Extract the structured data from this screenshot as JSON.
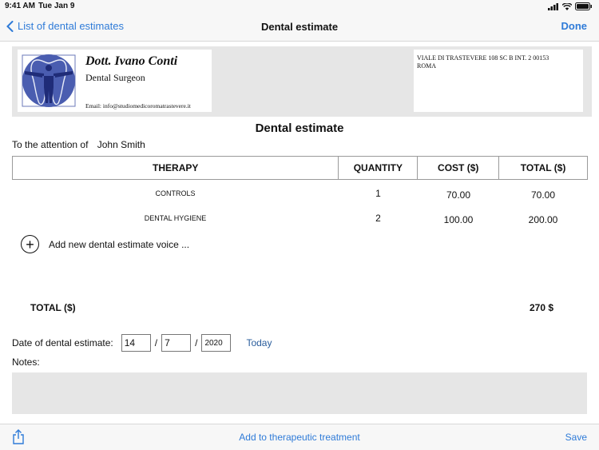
{
  "status_bar": {
    "time": "9:41 AM",
    "date": "Tue Jan 9"
  },
  "nav": {
    "back_label": "List of dental estimates",
    "title": "Dental estimate",
    "done_label": "Done"
  },
  "letterhead": {
    "doctor_name": "Dott. Ivano Conti",
    "role": "Dental Surgeon",
    "email": "Email: info@studiomedicoromatrastevere.it",
    "address_line1": "VIALE DI TRASTEVERE 108 SC B INT. 2 00153",
    "address_line2": "ROMA"
  },
  "document": {
    "heading": "Dental estimate",
    "attention_label": "To the attention of",
    "attention_name": "John Smith"
  },
  "table": {
    "headers": [
      "THERAPY",
      "QUANTITY",
      "COST ($)",
      "TOTAL ($)"
    ],
    "rows": [
      {
        "therapy": "CONTROLS",
        "quantity": "1",
        "cost": "70.00",
        "total": "70.00"
      },
      {
        "therapy": "DENTAL HYGIENE",
        "quantity": "2",
        "cost": "100.00",
        "total": "200.00"
      }
    ],
    "add_label": "Add new dental estimate voice ..."
  },
  "totals": {
    "label": "TOTAL ($)",
    "value": "270 $"
  },
  "date": {
    "label": "Date of dental estimate:",
    "day": "14",
    "month": "7",
    "year": "2020",
    "separator": "/",
    "today_label": "Today"
  },
  "notes": {
    "label": "Notes:",
    "value": ""
  },
  "toolbar": {
    "add_treatment_label": "Add to therapeutic treatment",
    "save_label": "Save"
  },
  "colors": {
    "accent": "#2f7bd8",
    "link_dark": "#2a5d9c",
    "logo_blue": "#4a5db0"
  }
}
